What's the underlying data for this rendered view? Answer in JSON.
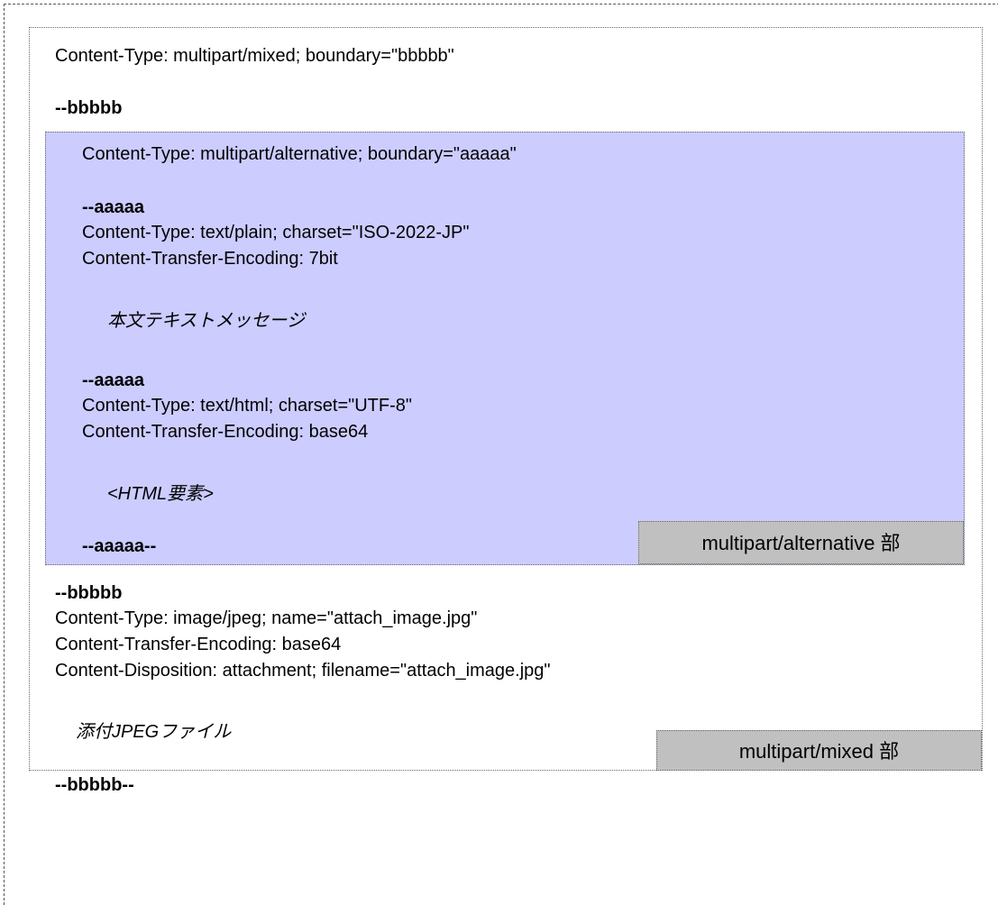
{
  "mixed": {
    "header": "Content-Type: multipart/mixed; boundary=\"bbbbb\"",
    "boundary1": "--bbbbb",
    "boundary2": "--bbbbb",
    "attach_lines": [
      "Content-Type: image/jpeg; name=\"attach_image.jpg\"",
      "Content-Transfer-Encoding: base64",
      "Content-Disposition: attachment; filename=\"attach_image.jpg\""
    ],
    "attach_body": "添付JPEGファイル",
    "end_boundary": "--bbbbb--",
    "label": "multipart/mixed 部"
  },
  "alternative": {
    "header": "Content-Type: multipart/alternative; boundary=\"aaaaa\"",
    "boundary1": "--aaaaa",
    "plain_lines": [
      "Content-Type: text/plain; charset=\"ISO-2022-JP\"",
      "Content-Transfer-Encoding: 7bit"
    ],
    "plain_body": "本文テキストメッセージ",
    "boundary2": "--aaaaa",
    "html_lines": [
      "Content-Type: text/html; charset=\"UTF-8\"",
      "Content-Transfer-Encoding: base64"
    ],
    "html_body": "<HTML要素>",
    "end_boundary": "--aaaaa--",
    "label": "multipart/alternative 部"
  }
}
